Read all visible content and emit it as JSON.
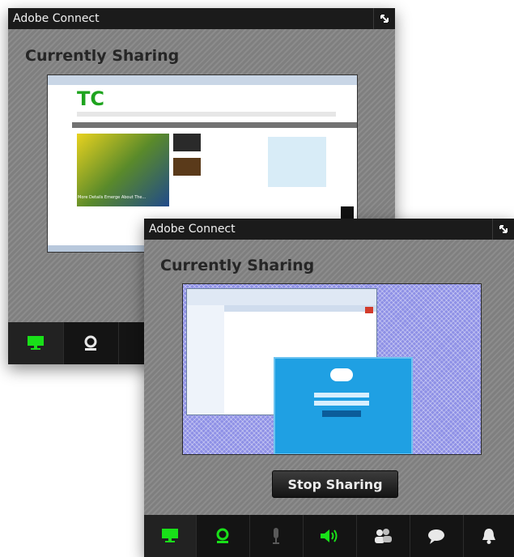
{
  "back_window": {
    "title": "Adobe Connect",
    "heading": "Currently Sharing",
    "toolbar": [
      {
        "icon": "screen-share-icon",
        "active": true
      },
      {
        "icon": "webcam-icon",
        "active": false
      }
    ],
    "shared_screen": {
      "browser_app": "web-browser",
      "site_logo": "TC",
      "featured_caption": "More Details Emerge About The..."
    }
  },
  "front_window": {
    "title": "Adobe Connect",
    "heading": "Currently Sharing",
    "stop_button": "Stop Sharing",
    "toolbar": [
      {
        "icon": "screen-share-icon",
        "active": true
      },
      {
        "icon": "webcam-icon",
        "active": false
      },
      {
        "icon": "microphone-icon",
        "active": false
      },
      {
        "icon": "speaker-icon",
        "active": false
      },
      {
        "icon": "attendees-icon",
        "active": false
      },
      {
        "icon": "chat-icon",
        "active": false
      },
      {
        "icon": "notification-bell-icon",
        "active": false
      }
    ],
    "shared_screen": {
      "apps": [
        "file-explorer",
        "skype"
      ]
    }
  },
  "colors": {
    "accent_green": "#19e019",
    "titlebar": "#1b1b1b",
    "panel_gray": "#7f7f7f",
    "share_bg": "#8e90e6",
    "skype_blue": "#1fa0e3"
  }
}
